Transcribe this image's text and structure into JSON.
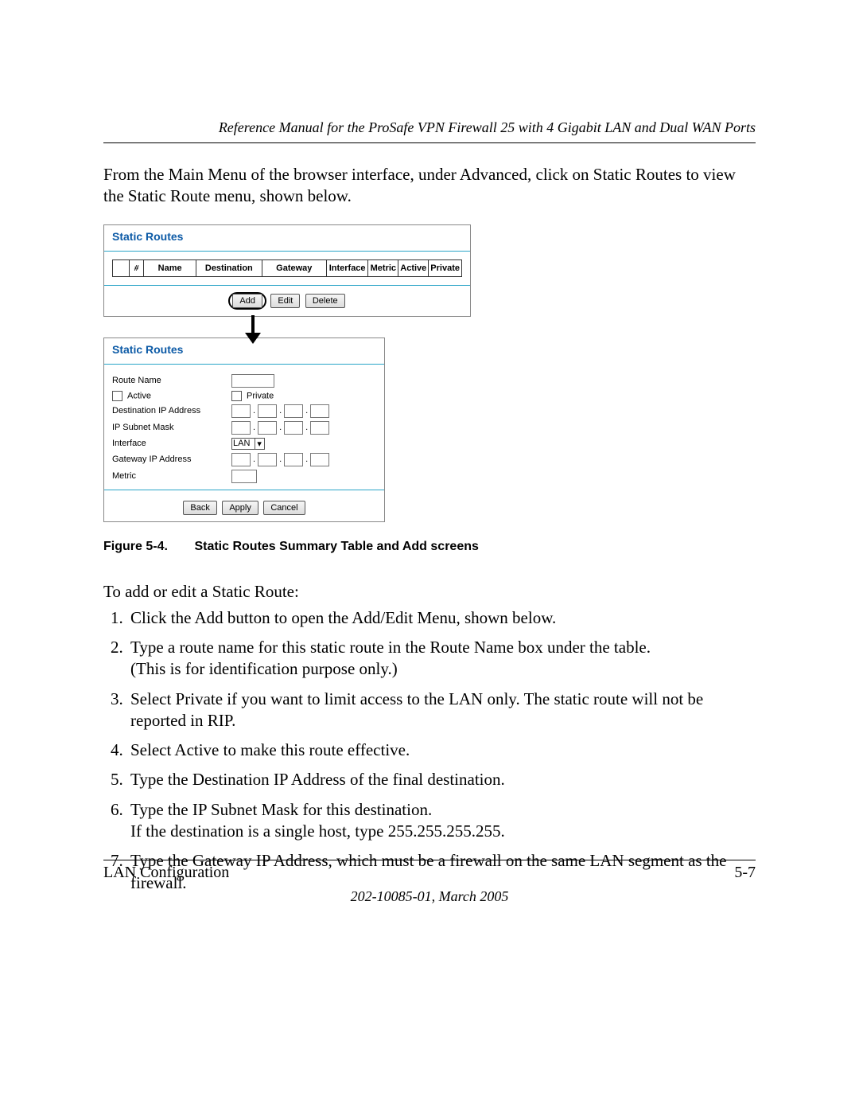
{
  "header": {
    "title": "Reference Manual for the ProSafe VPN Firewall 25 with 4 Gigabit LAN and Dual WAN Ports"
  },
  "intro": "From the Main Menu of the browser interface, under Advanced, click on Static Routes to view the Static Route menu, shown below.",
  "panel1": {
    "title": "Static Routes",
    "cols": {
      "num": "#",
      "name": "Name",
      "dest": "Destination",
      "gw": "Gateway",
      "iface": "Interface",
      "metric": "Metric",
      "active": "Active",
      "priv": "Private"
    },
    "buttons": {
      "add": "Add",
      "edit": "Edit",
      "delete": "Delete"
    }
  },
  "panel2": {
    "title": "Static Routes",
    "labels": {
      "routeName": "Route Name",
      "active": "Active",
      "private": "Private",
      "destIP": "Destination IP Address",
      "subnet": "IP Subnet Mask",
      "iface": "Interface",
      "gwIP": "Gateway IP Address",
      "metric": "Metric"
    },
    "ifaceValue": "LAN",
    "buttons": {
      "back": "Back",
      "apply": "Apply",
      "cancel": "Cancel"
    }
  },
  "caption": {
    "fignum": "Figure 5-4.",
    "text": "Static Routes Summary Table and Add screens"
  },
  "lead": "To add or edit a Static Route:",
  "steps": [
    "Click the Add button to open the Add/Edit Menu, shown below.",
    "Type a route name for this static route in the Route Name box under the table.\n(This is for identification purpose only.)",
    "Select Private if you want to limit access to the LAN only. The static route will not be reported in RIP.",
    "Select Active to make this route effective.",
    "Type the Destination IP Address of the final destination.",
    "Type the IP Subnet Mask for this destination.\nIf the destination is a single host, type 255.255.255.255.",
    "Type the Gateway IP Address, which must be a firewall on the same LAN segment as the firewall."
  ],
  "footer": {
    "left": "LAN Configuration",
    "right": "5-7",
    "docid": "202-10085-01, March 2005"
  }
}
